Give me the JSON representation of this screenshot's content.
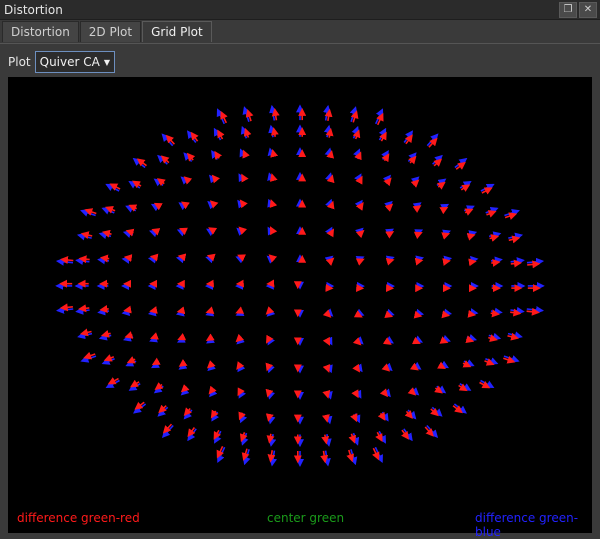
{
  "window": {
    "title": "Distortion"
  },
  "titlebar_buttons": {
    "float_icon": "float-icon",
    "close_icon": "close-icon"
  },
  "tabs": [
    {
      "label": "Distortion",
      "active": false
    },
    {
      "label": "2D Plot",
      "active": false
    },
    {
      "label": "Grid Plot",
      "active": true
    }
  ],
  "toolbar": {
    "plot_label": "Plot",
    "plot_value": "Quiver CA"
  },
  "legend": {
    "red": "difference green-red",
    "center": "center green",
    "blue": "difference green-blue"
  },
  "colors": {
    "red": "#ff1a1a",
    "center": "#1a9a1a",
    "blue": "#2222ff",
    "plot_bg": "#000000"
  },
  "chart_data": {
    "type": "quiver",
    "series": [
      {
        "name": "difference green-red",
        "color": "#ff1a1a"
      },
      {
        "name": "center green",
        "color": "#1a9a1a"
      },
      {
        "name": "difference green-blue",
        "color": "#2222ff"
      }
    ]
  }
}
